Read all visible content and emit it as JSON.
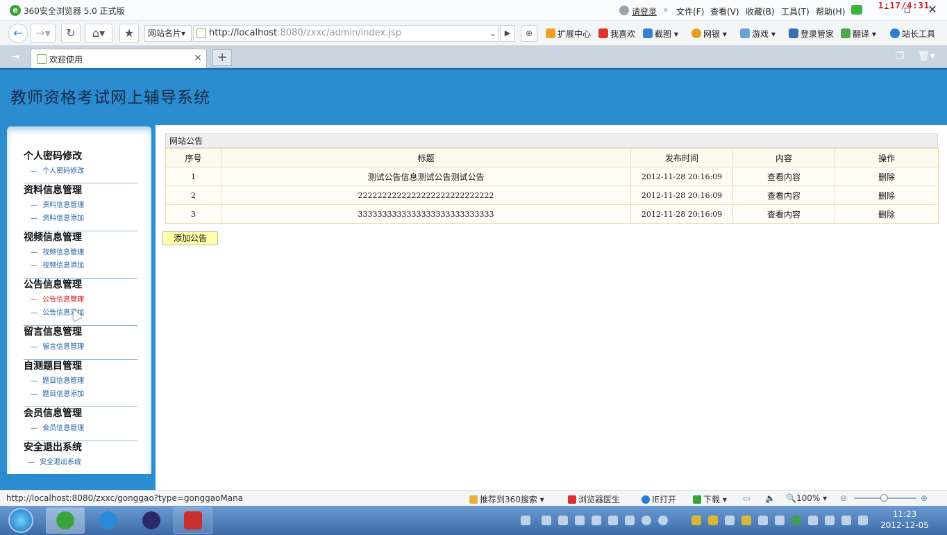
{
  "browser": {
    "title": "360安全浏览器 5.0 正式版",
    "login": "请登录",
    "menus": [
      "文件(F)",
      "查看(V)",
      "收藏(B)",
      "工具(T)",
      "帮助(H)"
    ],
    "overlay_time": "1:17/4:31",
    "site_card": "网站名片",
    "url_host": "http://localhost",
    "url_rest": ":8080/zxxc/admin/index.jsp",
    "toolbar": [
      "扩展中心",
      "我喜欢",
      "截图",
      "网银",
      "游戏",
      "登录管家",
      "翻译",
      "站长工具"
    ],
    "tab_label": "欢迎使用"
  },
  "site": {
    "title": "教师资格考试网上辅导系统"
  },
  "sidebar": {
    "groups": [
      {
        "title": "个人密码修改",
        "links": [
          "个人密码修改"
        ]
      },
      {
        "title": "资料信息管理",
        "links": [
          "资料信息管理",
          "资料信息添加"
        ]
      },
      {
        "title": "视频信息管理",
        "links": [
          "视频信息管理",
          "视频信息添加"
        ]
      },
      {
        "title": "公告信息管理",
        "links": [
          "公告信息管理",
          "公告信息添加"
        ]
      },
      {
        "title": "留言信息管理",
        "links": [
          "留言信息管理"
        ]
      },
      {
        "title": "自测题目管理",
        "links": [
          "题目信息管理",
          "题目信息添加"
        ]
      },
      {
        "title": "会员信息管理",
        "links": [
          "会员信息管理"
        ]
      },
      {
        "title": "安全退出系统",
        "links": [
          "安全退出系统"
        ]
      }
    ]
  },
  "notices": {
    "panel_title": "网站公告",
    "columns": [
      "序号",
      "标题",
      "发布时间",
      "内容",
      "操作"
    ],
    "rows": [
      {
        "no": "1",
        "title": "测试公告信息测试公告测试公告",
        "time": "2012-11-28 20:16:09",
        "view": "查看内容",
        "op": "删除"
      },
      {
        "no": "2",
        "title": "2222222222222222222222222222",
        "time": "2012-11-28 20:16:09",
        "view": "查看内容",
        "op": "删除"
      },
      {
        "no": "3",
        "title": "3333333333333333333333333333",
        "time": "2012-11-28 20:16:09",
        "view": "查看内容",
        "op": "删除"
      }
    ],
    "add_button": "添加公告"
  },
  "statusbar": {
    "url": "http://localhost:8080/zxxc/gonggao?type=gonggaoMana",
    "items": [
      "推荐到360搜索",
      "浏览器医生",
      "IE打开",
      "下载"
    ],
    "zoom": "100%"
  },
  "taskbar": {
    "time": "11:23",
    "date": "2012-12-05"
  }
}
